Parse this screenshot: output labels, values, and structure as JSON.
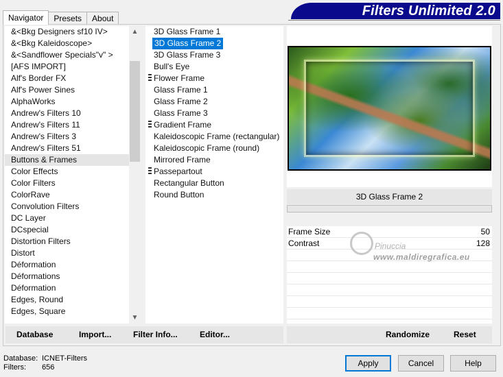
{
  "tabs": [
    "Navigator",
    "Presets",
    "About"
  ],
  "active_tab": "Navigator",
  "title": "Filters Unlimited 2.0",
  "categories": [
    "&<Bkg Designers sf10 IV>",
    "&<Bkg Kaleidoscope>",
    "&<Sandflower Specials\"v\" >",
    "[AFS IMPORT]",
    "Alf's Border FX",
    "Alf's Power Sines",
    "AlphaWorks",
    "Andrew's Filters 10",
    "Andrew's Filters 11",
    "Andrew's Filters 3",
    "Andrew's Filters 51",
    "Buttons & Frames",
    "Color Effects",
    "Color Filters",
    "ColorRave",
    "Convolution Filters",
    "DC Layer",
    "DCspecial",
    "Distortion Filters",
    "Distort",
    "Déformation",
    "Déformations",
    "Déformation",
    "Edges, Round",
    "Edges, Square"
  ],
  "selected_category_index": 11,
  "filters": [
    {
      "label": "3D Glass Frame 1",
      "grip": false
    },
    {
      "label": "3D Glass Frame 2",
      "grip": false
    },
    {
      "label": "3D Glass Frame 3",
      "grip": false
    },
    {
      "label": "Bull's Eye",
      "grip": false
    },
    {
      "label": "Flower Frame",
      "grip": true
    },
    {
      "label": "Glass Frame 1",
      "grip": false
    },
    {
      "label": "Glass Frame 2",
      "grip": false
    },
    {
      "label": "Glass Frame 3",
      "grip": false
    },
    {
      "label": "Gradient Frame",
      "grip": true
    },
    {
      "label": "Kaleidoscopic Frame (rectangular)",
      "grip": false
    },
    {
      "label": "Kaleidoscopic Frame (round)",
      "grip": false
    },
    {
      "label": "Mirrored Frame",
      "grip": false
    },
    {
      "label": "Passepartout",
      "grip": true
    },
    {
      "label": "Rectangular Button",
      "grip": false
    },
    {
      "label": "Round Button",
      "grip": false
    }
  ],
  "selected_filter_index": 1,
  "filter_name": "3D Glass Frame 2",
  "params": [
    {
      "label": "Frame Size",
      "value": "50"
    },
    {
      "label": "Contrast",
      "value": "128"
    }
  ],
  "watermark": {
    "name": "Pinuccia",
    "site": "www.maldiregrafica.eu"
  },
  "left_buttons": [
    "Database",
    "Import...",
    "Filter Info...",
    "Editor..."
  ],
  "right_buttons": [
    "Randomize",
    "Reset"
  ],
  "status": {
    "database_label": "Database:",
    "database_value": "ICNET-Filters",
    "filters_label": "Filters:",
    "filters_value": "656"
  },
  "dialog_buttons": {
    "apply": "Apply",
    "cancel": "Cancel",
    "help": "Help"
  },
  "colors": {
    "accent": "#0078d7",
    "banner": "#0a0a8c"
  }
}
